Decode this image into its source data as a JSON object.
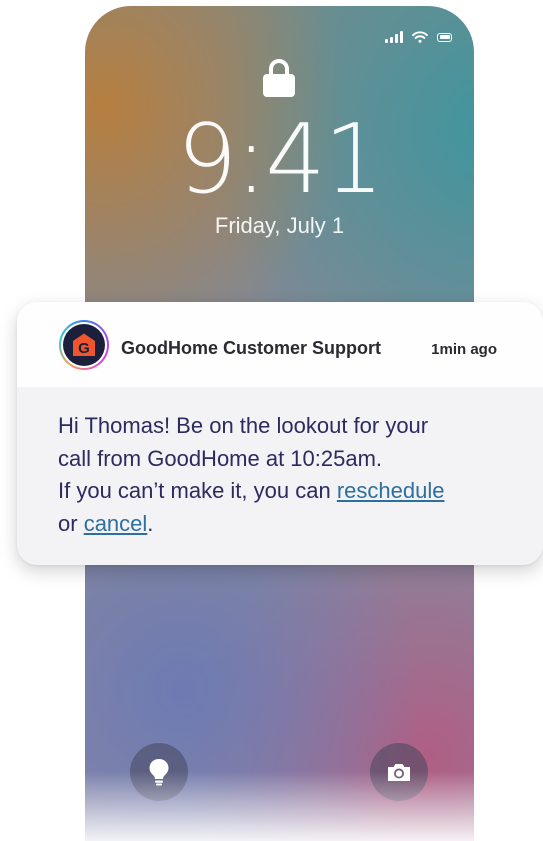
{
  "lock_screen": {
    "time": "9:41",
    "date": "Friday, July 1"
  },
  "status_bar": {
    "icons": [
      "signal-icon",
      "wifi-icon",
      "battery-icon"
    ]
  },
  "notification": {
    "app_icon": "goodhome-logo",
    "logo_letter": "G",
    "sender": "GoodHome Customer Support",
    "time_ago": "1min ago",
    "message_line1": "Hi Thomas! Be on the lookout for your",
    "message_line2": "call from GoodHome at 10:25am.",
    "message_line3_prefix": "If you can’t make it, you can ",
    "reschedule_link": "reschedule",
    "message_line4_prefix": "or ",
    "cancel_link": "cancel",
    "message_end": "."
  },
  "quick_actions": {
    "left_icon": "flashlight-icon",
    "right_icon": "camera-icon"
  },
  "colors": {
    "brand_orange": "#f0552b",
    "logo_background": "#1b1f3b",
    "link": "#2d6f9e",
    "message_text": "#2c2a5e"
  }
}
